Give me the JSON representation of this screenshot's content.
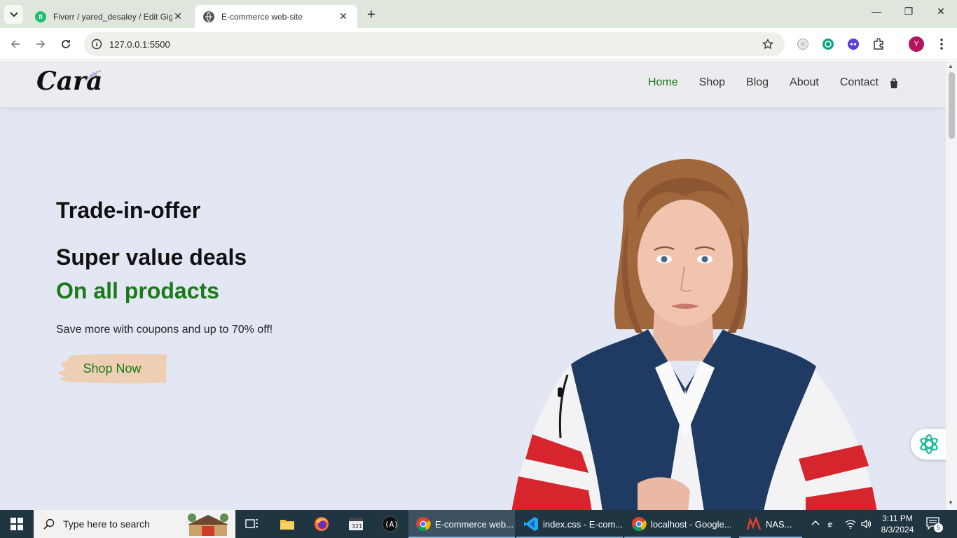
{
  "browser": {
    "tabs": [
      {
        "title": "Fiverr / yared_desaley / Edit Gig",
        "favicon": "fiverr-icon"
      },
      {
        "title": "E-commerce web-site",
        "favicon": "globe-icon"
      }
    ],
    "url": "127.0.0.1:5500",
    "profile_initial": "Y"
  },
  "site": {
    "logo": "Cara",
    "nav": [
      "Home",
      "Shop",
      "Blog",
      "About",
      "Contact"
    ],
    "hero": {
      "kicker": "Trade-in-offer",
      "headline": "Super value deals",
      "highlight": "On all prodacts",
      "text": "Save more with coupons and up to 70% off!",
      "button": "Shop Now"
    },
    "colors": {
      "accent": "#1a7a1a",
      "hero_bg": "#e3e6f3",
      "button_brush": "#eecfb3"
    }
  },
  "taskbar": {
    "search_placeholder": "Type here to search",
    "apps": [
      {
        "label": "E-commerce web...",
        "icon": "chrome-icon"
      },
      {
        "label": "index.css - E-com...",
        "icon": "vscode-icon"
      },
      {
        "label": "localhost - Google...",
        "icon": "chrome-icon"
      },
      {
        "label": "NAS...",
        "icon": "app-icon"
      }
    ],
    "time": "3:11 PM",
    "date": "8/3/2024",
    "notification_count": "5"
  }
}
